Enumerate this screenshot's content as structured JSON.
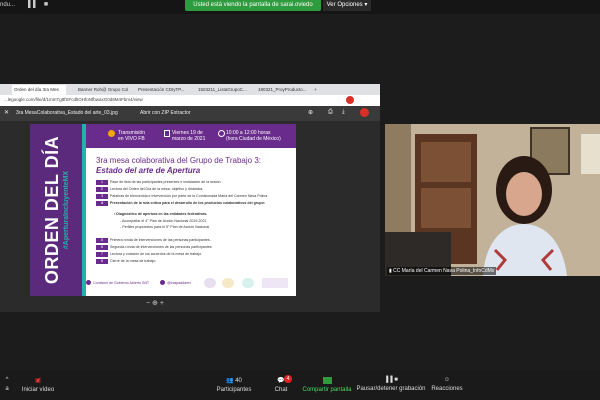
{
  "topbar": {
    "mini_title": "ndu...",
    "share_banner": "Usted está viendo la pantalla de sarai.oviedo",
    "view_options": "Ver Opciones ▾"
  },
  "browser": {
    "tabs": [
      {
        "label": "Orden del día 3ra Mes",
        "active": true
      },
      {
        "label": "Banner Roh@ Grupo Col..."
      },
      {
        "label": "Presentación CDIyTP..."
      },
      {
        "label": "1503211_ListaGrupoC..."
      },
      {
        "label": "190321_ProyProducto..."
      }
    ],
    "url": "...legoogle.com/file/d/1mmTg8fSFcdlIOHfoNfbwaxG0d8M4Fbm4/view",
    "filename": "3ra MesaColaborativa_Estado del arte_03.jpg",
    "reader_button": "Abrir con ZIP Extractor"
  },
  "slide": {
    "vertical_title": "ORDEN DEL DÍA",
    "hashtag": "#AperturaIncluyenteMX",
    "transmision": [
      "Transmisión",
      "en VIVO FB"
    ],
    "date": [
      "Viernes 19 de",
      "marzo de 2021"
    ],
    "time": [
      "10:00 a 12:00 horas",
      "(hora Ciudad de México)"
    ],
    "title_line1": "3ra mesa colaborativa del Grupo de Trabajo 3:",
    "title_line2": "Estado del arte de Apertura",
    "agenda": [
      {
        "num": "1",
        "text": "Pase de lista de las participantes presentes e instalación de la sesión."
      },
      {
        "num": "2",
        "text": "Lectura del Orden del Día de la mesa, objetivo y dinámica."
      },
      {
        "num": "3",
        "text": "Palabras de bienvenida e intervención por parte de la Comisionada María del Carmen Nava Polina."
      },
      {
        "num": "4",
        "text": "Presentación de la ruta crítica para el desarrollo de los productos colaborativos del grupo:"
      },
      {
        "num": "",
        "text": "• Diagnóstico de apertura en las entidades federativas.",
        "sub": true
      },
      {
        "num": "",
        "text": "- Acompañar el 4° Plan de Acción Nacional 2019-2021",
        "sub": true
      },
      {
        "num": "",
        "text": "- Perfiles propuestos para el 5° Plan de Acción Nacional",
        "sub": true
      },
      {
        "num": "5",
        "text": "Primera ronda de intervenciones de las personas participantes."
      },
      {
        "num": "6",
        "text": "Segunda ronda de intervenciones de las personas participantes."
      },
      {
        "num": "7",
        "text": "Lectura y votación de los acuerdos de la mesa de trabajo."
      },
      {
        "num": "8",
        "text": "Cierre de la mesa de trabajo."
      }
    ],
    "footer": [
      "Comisión de Gobierno Abierto SNT",
      "@inaipaddamx"
    ]
  },
  "viewer_tools": "−  ⊕  +",
  "video": {
    "participant_name": "CC María del Carmen Nava Polina_InfoCdMx"
  },
  "toolbar": {
    "items": [
      {
        "label": "Iniciar vídeo",
        "icon": "video-off-icon"
      },
      {
        "label": "Participantes",
        "icon": "participants-icon",
        "count": "40"
      },
      {
        "label": "Chat",
        "icon": "chat-icon",
        "badge": "4"
      },
      {
        "label": "Compartir pantalla",
        "icon": "share-screen-icon"
      },
      {
        "label": "Pausar/detener grabación",
        "icon": "pause-record-icon"
      },
      {
        "label": "Reacciones",
        "icon": "reactions-icon"
      }
    ]
  },
  "colors": {
    "accent_green": "#2e9b3e",
    "slide_purple": "#6a2c8c",
    "slide_teal": "#22b3a8"
  }
}
